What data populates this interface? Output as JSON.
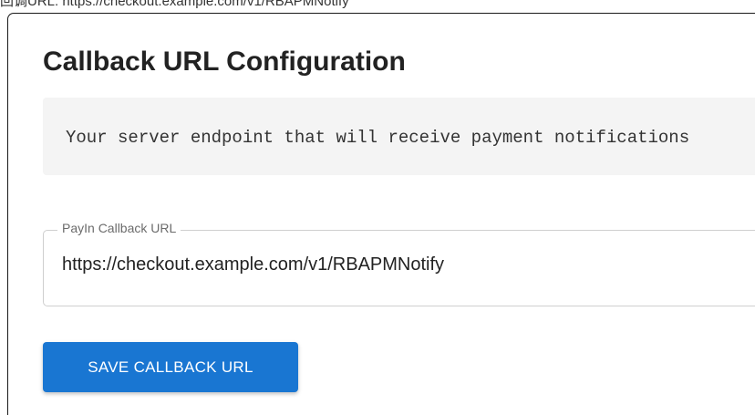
{
  "top_text": "回调URL: https://checkout.example.com/v1/RBAPMNotify",
  "page": {
    "title": "Callback URL Configuration",
    "description": "Your server endpoint that will receive payment notifications"
  },
  "field": {
    "label": "PayIn Callback URL",
    "value": "https://checkout.example.com/v1/RBAPMNotify"
  },
  "actions": {
    "save_label": "SAVE CALLBACK URL"
  },
  "colors": {
    "primary": "#1976d2",
    "description_background": "#f4f4f4",
    "field_border": "#cfcfcf"
  }
}
